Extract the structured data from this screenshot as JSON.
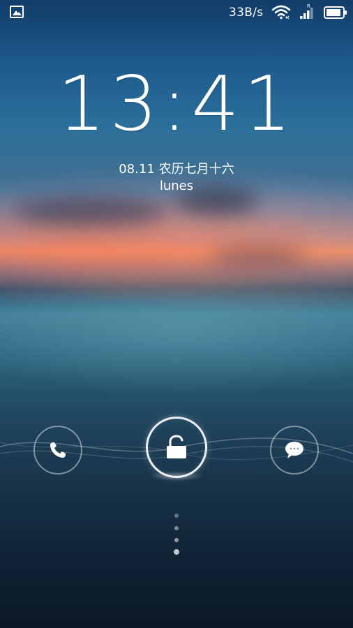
{
  "status_bar": {
    "left_icon": "gallery-image-icon",
    "net_speed": "33B/s",
    "wifi_icon": "wifi-icon",
    "signal_icon": "signal-icon",
    "signal_roaming_label": "R",
    "battery_icon": "battery-icon"
  },
  "lockscreen": {
    "time": "13:41",
    "date": "08.11",
    "lunar_date": "农历七月十六",
    "weekday": "lunes"
  },
  "shortcuts": {
    "phone_icon": "phone-icon",
    "unlock_icon": "unlock-icon",
    "messages_icon": "message-bubble-icon"
  },
  "page_indicator": {
    "dot_count": 4
  },
  "colors": {
    "text": "#ffffff",
    "sky_top": "#123c68",
    "sunset": "#e08f73",
    "sea": "#3f7f95"
  }
}
